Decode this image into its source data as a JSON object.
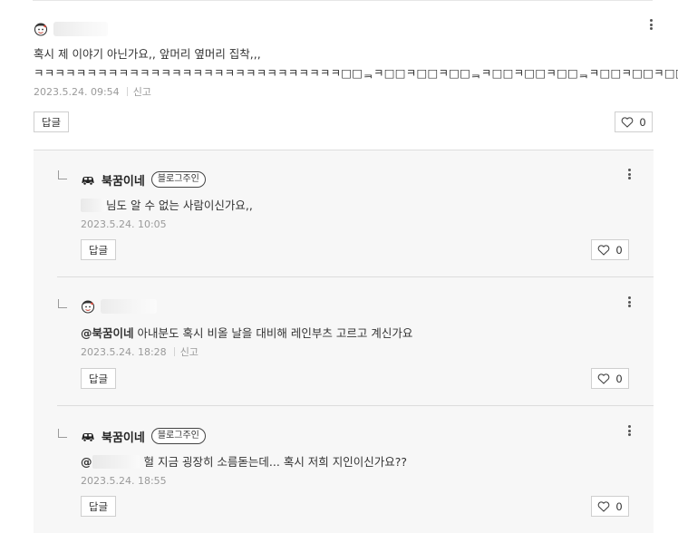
{
  "main_comment": {
    "line1": "혹시 제 이야기 아닌가요,, 앞머리 옆머리 집착,,,",
    "line2": "ㅋㅋㅋㅋㅋㅋㅋㅋㅋㅋㅋㅋㅋㅋㅋㅋㅋㅋㅋㅋㅋㅋㅋㅋㅋㅋㅋㅋㅋ□□ᆿㅋ□□ㅋ□□ㅋ□□ᆿㅋ□□ㅋ□□ㅋ□□ᆿㅋ□□ㅋ□□ㅋ□□",
    "date": "2023.5.24. 09:54",
    "report_label": "신고",
    "reply_label": "답글",
    "like_count": "0"
  },
  "replies": [
    {
      "author": "북꿈이네",
      "badge": "블로그주인",
      "text": "님도 알 수 없는 사람이신가요,,",
      "date": "2023.5.24. 10:05",
      "reply_label": "답글",
      "like_count": "0"
    },
    {
      "mention": "@북꿈이네",
      "text": "아내분도 혹시 비올 날을 대비해 레인부츠 고르고 계신가요",
      "date": "2023.5.24. 18:28",
      "report_label": "신고",
      "reply_label": "답글",
      "like_count": "0"
    },
    {
      "author": "북꿈이네",
      "badge": "블로그주인",
      "mention": "@",
      "text": "헐 지금 굉장히 소름돋는데... 혹시 저희 지인이신가요??",
      "date": "2023.5.24. 18:55",
      "reply_label": "답글",
      "like_count": "0"
    }
  ],
  "icons": {
    "avatar": "cartoon-face-avatar",
    "owner_avatar": "car-icon",
    "more": "more-vertical-icon",
    "like": "heart-outline-icon",
    "reply_arrow": "reply-corner-icon"
  }
}
